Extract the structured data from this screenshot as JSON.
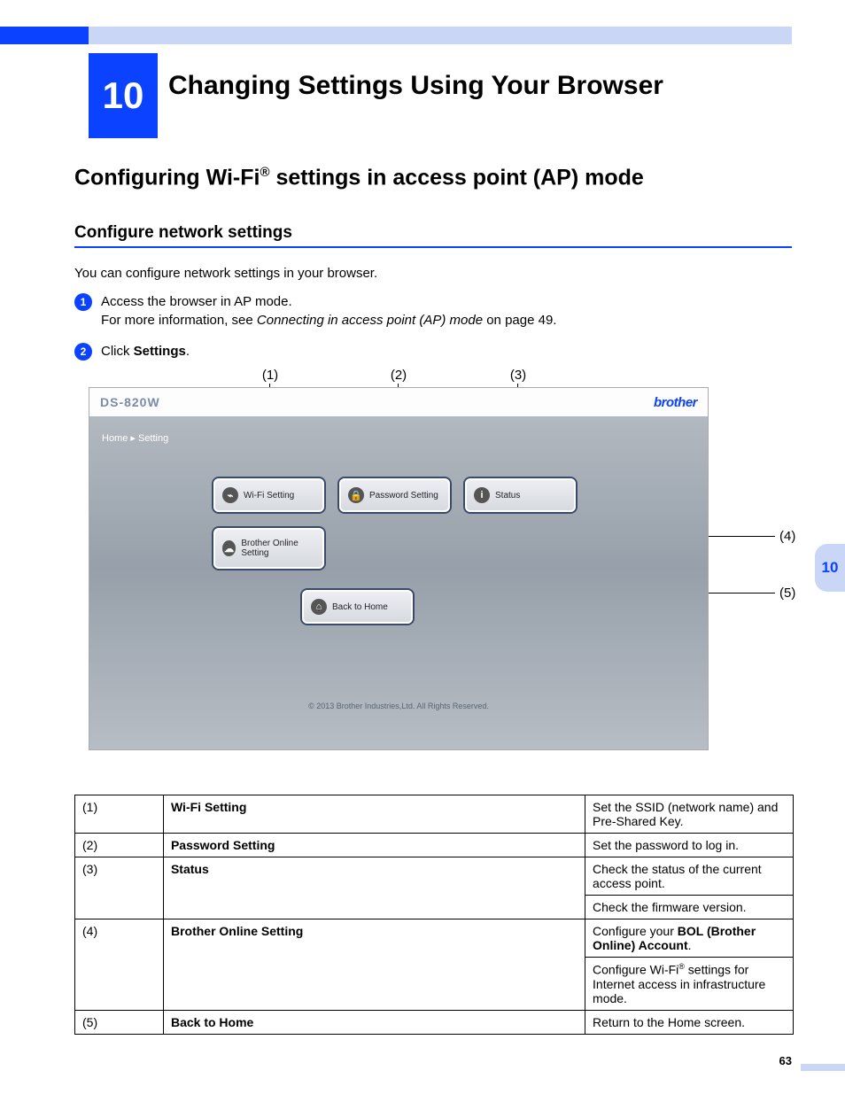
{
  "chapter": {
    "number": "10",
    "title": "Changing Settings Using Your Browser"
  },
  "h1_pre": "Configuring Wi-Fi",
  "h1_sup": "®",
  "h1_post": " settings in access point (AP) mode",
  "h2": "Configure network settings",
  "intro": "You can configure network settings in your browser.",
  "steps": {
    "s1": {
      "num": "1",
      "line1": "Access the browser in AP mode.",
      "line2a": "For more information, see ",
      "line2b_italic": "Connecting in access point (AP) mode",
      "line2c": " on page 49."
    },
    "s2": {
      "num": "2",
      "pre": "Click ",
      "bold": "Settings",
      "post": "."
    }
  },
  "callouts": {
    "c1": "(1)",
    "c2": "(2)",
    "c3": "(3)",
    "c4": "(4)",
    "c5": "(5)"
  },
  "shot": {
    "model": "DS-820W",
    "brand": "brother",
    "crumb": "Home  ▸  Setting",
    "btn_wifi": "Wi-Fi  Setting",
    "btn_pass": "Password Setting",
    "btn_status": "Status",
    "btn_bol": "Brother Online Setting",
    "btn_home": "Back to Home",
    "copy": "© 2013 Brother Industries,Ltd. All Rights Reserved."
  },
  "table": {
    "r1": {
      "n": "(1)",
      "name": "Wi-Fi Setting",
      "desc": "Set the SSID (network name) and Pre-Shared Key."
    },
    "r2": {
      "n": "(2)",
      "name": "Password Setting",
      "desc": "Set the password to log in."
    },
    "r3": {
      "n": "(3)",
      "name": "Status",
      "desc1": "Check the status of the current access point.",
      "desc2": "Check the firmware version."
    },
    "r4": {
      "n": "(4)",
      "name": "Brother Online Setting",
      "desc1_pre": "Configure your ",
      "desc1_bold": "BOL (Brother Online) Account",
      "desc1_post": ".",
      "desc2_pre": "Configure Wi-Fi",
      "desc2_sup": "®",
      "desc2_post": " settings for Internet access in infrastructure mode."
    },
    "r5": {
      "n": "(5)",
      "name": "Back to Home",
      "desc": "Return to the Home screen."
    }
  },
  "side_tab": "10",
  "page_number": "63",
  "icons": {
    "wifi": "⌁",
    "lock": "🔒",
    "info": "i",
    "cloud": "☁",
    "home": "⌂"
  }
}
